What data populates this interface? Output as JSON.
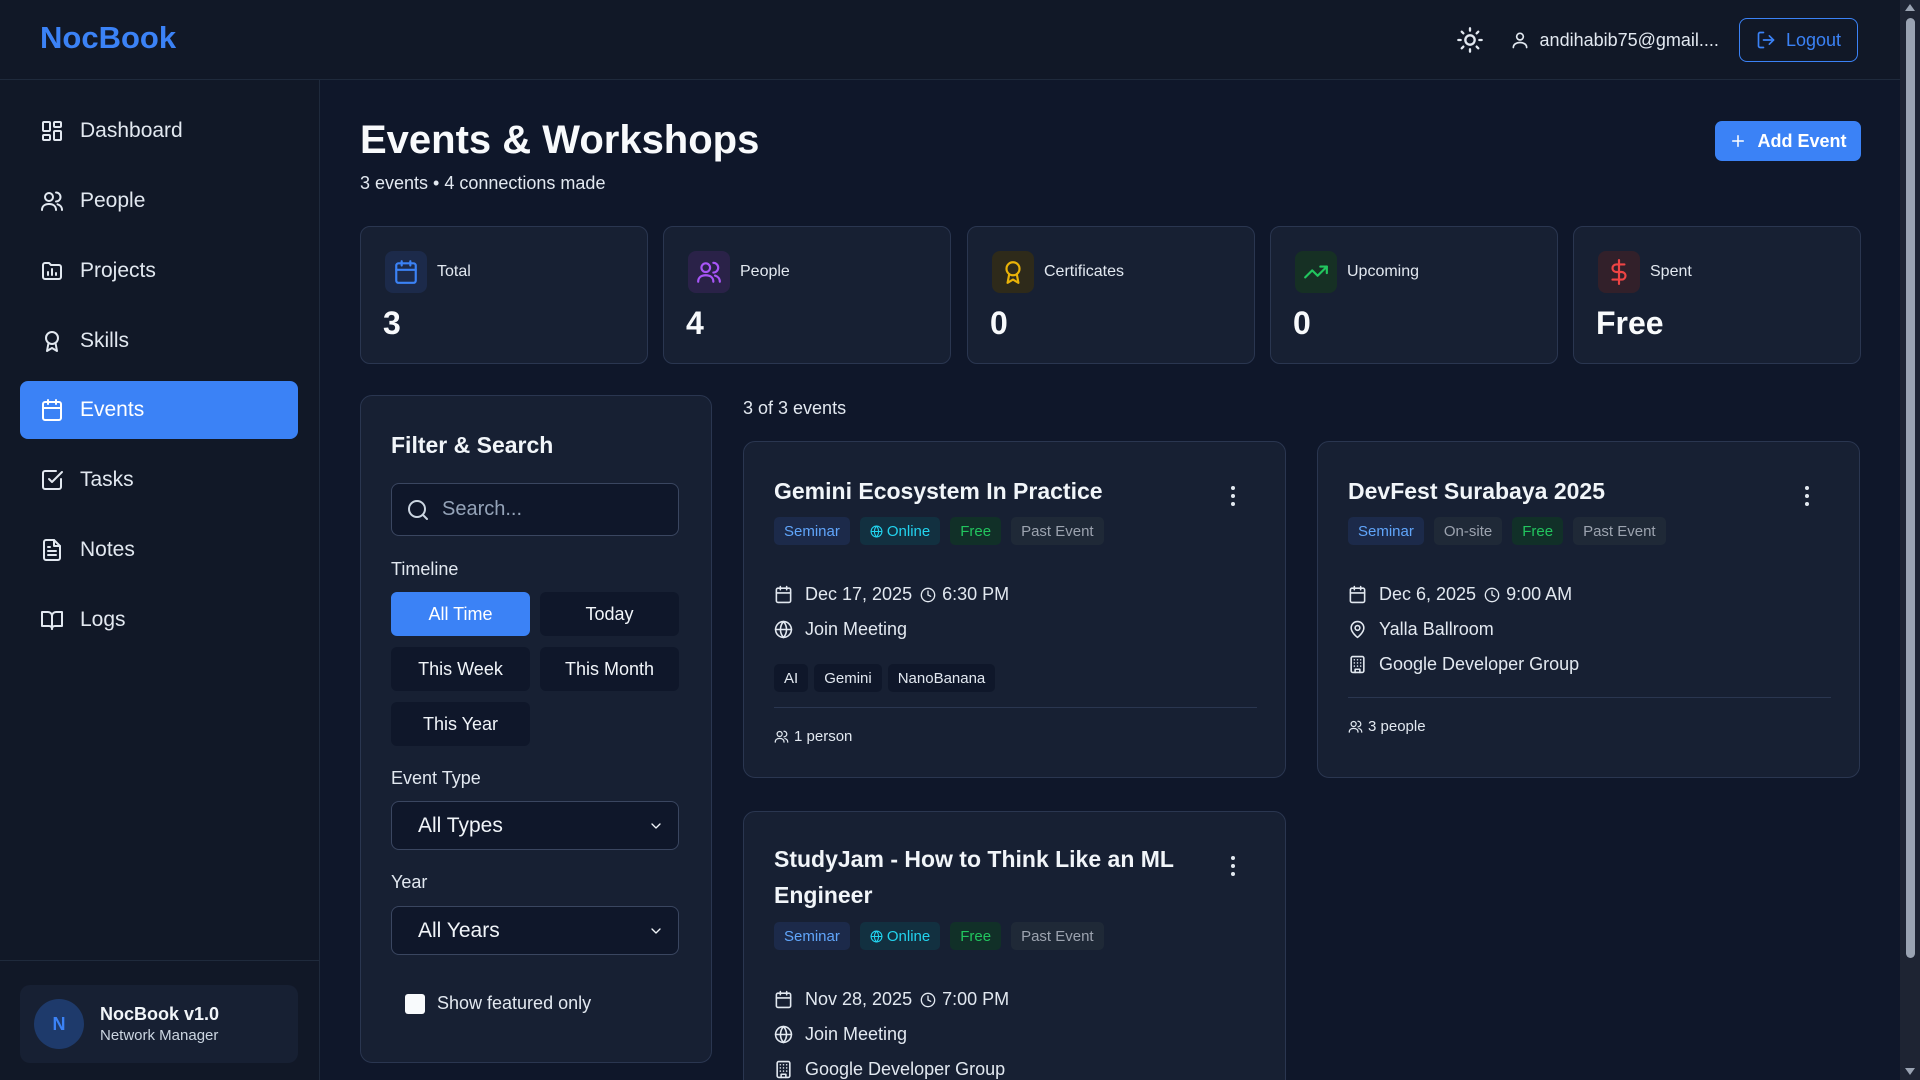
{
  "app": {
    "brand": "NocBook"
  },
  "header": {
    "user_email": "andihabib75@gmail....",
    "logout_label": "Logout"
  },
  "sidebar": {
    "items": [
      {
        "label": "Dashboard",
        "icon": "dashboard-icon"
      },
      {
        "label": "People",
        "icon": "users-icon"
      },
      {
        "label": "Projects",
        "icon": "folder-chart-icon"
      },
      {
        "label": "Skills",
        "icon": "award-icon"
      },
      {
        "label": "Events",
        "icon": "calendar-icon",
        "active": true
      },
      {
        "label": "Tasks",
        "icon": "checkbox-icon"
      },
      {
        "label": "Notes",
        "icon": "document-icon"
      },
      {
        "label": "Logs",
        "icon": "book-icon"
      }
    ],
    "footer": {
      "avatar_letter": "N",
      "title": "NocBook v1.0",
      "subtitle": "Network Manager"
    }
  },
  "page": {
    "title": "Events & Workshops",
    "subtitle": "3 events • 4 connections made",
    "add_button": "Add Event"
  },
  "stats": [
    {
      "label": "Total",
      "value": "3",
      "icon": "calendar-icon",
      "color": "#3b82f6"
    },
    {
      "label": "People",
      "value": "4",
      "icon": "users-icon",
      "color": "#a855f7"
    },
    {
      "label": "Certificates",
      "value": "0",
      "icon": "award-icon",
      "color": "#eab308"
    },
    {
      "label": "Upcoming",
      "value": "0",
      "icon": "trending-up-icon",
      "color": "#22c55e"
    },
    {
      "label": "Spent",
      "value": "Free",
      "icon": "dollar-icon",
      "color": "#ef4444"
    }
  ],
  "filter": {
    "title": "Filter & Search",
    "search_placeholder": "Search...",
    "timeline_label": "Timeline",
    "timeline_options": [
      "All Time",
      "Today",
      "This Week",
      "This Month",
      "This Year"
    ],
    "timeline_selected": "All Time",
    "event_type_label": "Event Type",
    "event_type_value": "All Types",
    "year_label": "Year",
    "year_value": "All Years",
    "featured_label": "Show featured only",
    "featured_checked": false
  },
  "results": {
    "count_text": "3 of 3 events"
  },
  "events": [
    {
      "title": "Gemini Ecosystem In Practice",
      "badges": {
        "type": "Seminar",
        "mode": "Online",
        "price": "Free",
        "status": "Past Event"
      },
      "date": "Dec 17, 2025",
      "time": "6:30 PM",
      "location": "Join Meeting",
      "tags": [
        "AI",
        "Gemini",
        "NanoBanana"
      ],
      "people": "1 person"
    },
    {
      "title": "DevFest Surabaya 2025",
      "badges": {
        "type": "Seminar",
        "mode": "On-site",
        "price": "Free",
        "status": "Past Event"
      },
      "date": "Dec 6, 2025",
      "time": "9:00 AM",
      "location": "Yalla Ballroom",
      "organizer": "Google Developer Group",
      "people": "3 people"
    },
    {
      "title": "StudyJam - How to Think Like an ML Engineer",
      "badges": {
        "type": "Seminar",
        "mode": "Online",
        "price": "Free",
        "status": "Past Event"
      },
      "date": "Nov 28, 2025",
      "time": "7:00 PM",
      "location": "Join Meeting",
      "organizer": "Google Developer Group"
    }
  ]
}
